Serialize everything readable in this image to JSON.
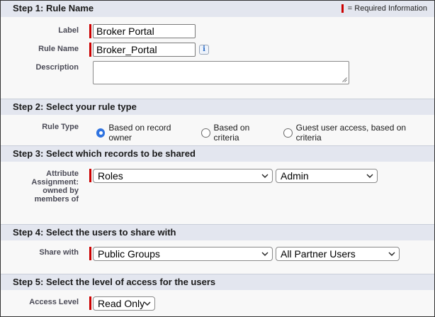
{
  "required_legend": "= Required Information",
  "colors": {
    "required": "#cc0000",
    "section_header_bg": "#e3e6ef",
    "radio_accent": "#2f73e0"
  },
  "step1": {
    "title": "Step 1: Rule Name",
    "label_label": "Label",
    "label_value": "Broker Portal",
    "rule_name_label": "Rule Name",
    "rule_name_value": "Broker_Portal",
    "info_icon": "i",
    "description_label": "Description",
    "description_value": ""
  },
  "step2": {
    "title": "Step 2: Select your rule type",
    "rule_type_label": "Rule Type",
    "options": [
      {
        "label": "Based on record owner",
        "checked": true
      },
      {
        "label": "Based on criteria",
        "checked": false
      },
      {
        "label": "Guest user access, based on criteria",
        "checked": false
      }
    ]
  },
  "step3": {
    "title": "Step 3: Select which records to be shared",
    "attribute_label_line1": "Attribute",
    "attribute_label_line2": "Assignment:",
    "attribute_label_line3": "owned by",
    "attribute_label_line4": "members of",
    "type_select": "Roles",
    "value_select": "Admin"
  },
  "step4": {
    "title": "Step 4: Select the users to share with",
    "share_with_label": "Share with",
    "type_select": "Public Groups",
    "value_select": "All Partner Users"
  },
  "step5": {
    "title": "Step 5: Select the level of access for the users",
    "access_level_label": "Access Level",
    "access_select": "Read Only"
  }
}
